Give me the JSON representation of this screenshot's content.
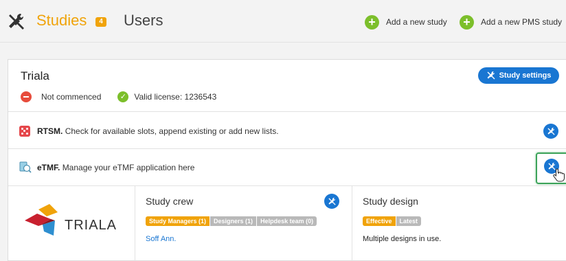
{
  "nav": {
    "studies_label": "Studies",
    "studies_count": "4",
    "users_label": "Users",
    "add_study_label": "Add a new study",
    "add_pms_label": "Add a new PMS study",
    "add_symbol": "+"
  },
  "study": {
    "title": "Triala",
    "status_label": "Not commenced",
    "license_label": "Valid license: 1236543",
    "settings_label": "Study settings"
  },
  "rtsm": {
    "name": "RTSM.",
    "description": "Check for available slots, append existing or add new lists."
  },
  "etmf": {
    "name": "eTMF.",
    "description": "Manage your eTMF application here"
  },
  "logo": {
    "text": "TRIALA"
  },
  "crew": {
    "title": "Study crew",
    "tags": [
      "Study Managers (1)",
      "Designers (1)",
      "Helpdesk team (0)"
    ],
    "member": "Soff Ann."
  },
  "design": {
    "title": "Study design",
    "tags": [
      "Effective",
      "Latest"
    ],
    "note": "Multiple designs in use."
  },
  "colors": {
    "accent_orange": "#f0a30a",
    "primary_blue": "#1976d2",
    "success_green": "#7cbf2b",
    "danger_red": "#e74c3c",
    "focus_green": "#3ca35a"
  }
}
